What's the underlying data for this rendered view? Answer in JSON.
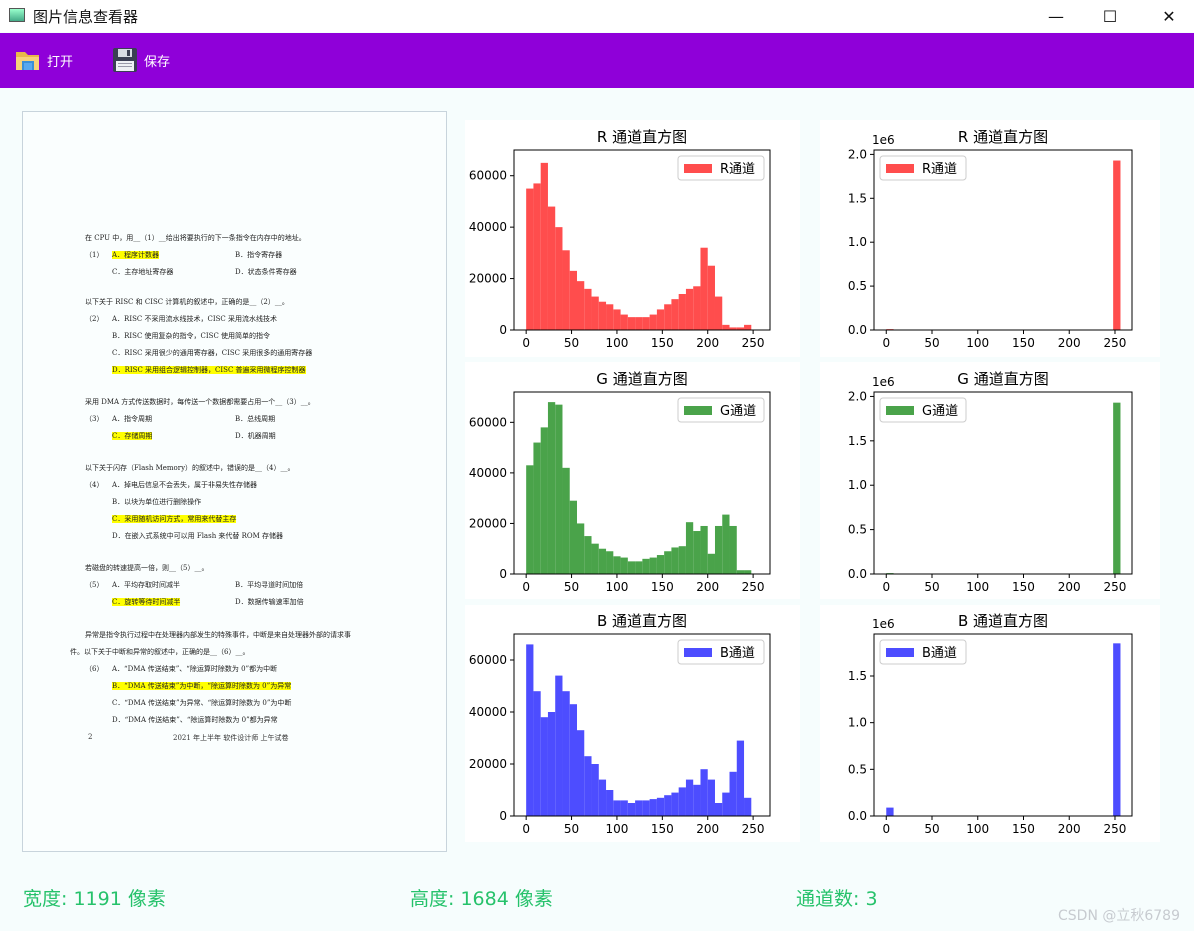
{
  "window": {
    "title": "图片信息查看器",
    "minimize": "—",
    "maximize": "☐",
    "close": "✕"
  },
  "toolbar": {
    "open": {
      "label": "打开",
      "icon": "folder-icon"
    },
    "save": {
      "label": "保存",
      "icon": "floppy-disk-icon"
    }
  },
  "document": {
    "questions": [
      {
        "stem": "在 CPU 中，用__（1）__给出将要执行的下一条指令在内存中的地址。",
        "rows": [
          [
            {
              "text": "（1）",
              "w": 27
            },
            {
              "text": "A．程序计数器",
              "w": 123,
              "hl": true
            },
            {
              "text": "B．指令寄存器"
            }
          ],
          [
            {
              "text": "",
              "w": 27
            },
            {
              "text": "C．主存地址寄存器",
              "w": 123
            },
            {
              "text": "D．状态条件寄存器"
            }
          ]
        ]
      },
      {
        "stem": "以下关于 RISC 和 CISC 计算机的叙述中，正确的是__（2）__。",
        "rows": [
          [
            {
              "text": "（2）",
              "w": 27
            },
            {
              "text": "A．RISC 不采用流水线技术，CISC 采用流水线技术"
            }
          ],
          [
            {
              "text": "",
              "w": 27
            },
            {
              "text": "B．RISC 使用复杂的指令，CISC 使用简单的指令"
            }
          ],
          [
            {
              "text": "",
              "w": 27
            },
            {
              "text": "C．RISC 采用很少的通用寄存器，CISC 采用很多的通用寄存器"
            }
          ],
          [
            {
              "text": "",
              "w": 27
            },
            {
              "text": "D．RISC 采用组合逻辑控制器，CISC 普遍采用微程序控制器",
              "hl": true
            }
          ]
        ]
      },
      {
        "stem": "采用 DMA 方式传送数据时，每传送一个数据都需要占用一个__（3）__。",
        "rows": [
          [
            {
              "text": "（3）",
              "w": 27
            },
            {
              "text": "A．指令周期",
              "w": 123
            },
            {
              "text": "B．总线周期"
            }
          ],
          [
            {
              "text": "",
              "w": 27
            },
            {
              "text": "C．存储周期",
              "w": 123,
              "hl": true
            },
            {
              "text": "D．机器周期"
            }
          ]
        ]
      },
      {
        "stem": "以下关于闪存（Flash Memory）的叙述中，错误的是__（4）__。",
        "rows": [
          [
            {
              "text": "（4）",
              "w": 27
            },
            {
              "text": "A．掉电后信息不会丢失，属于非易失性存储器"
            }
          ],
          [
            {
              "text": "",
              "w": 27
            },
            {
              "text": "B．以块为单位进行删除操作"
            }
          ],
          [
            {
              "text": "",
              "w": 27
            },
            {
              "text": "C．采用随机访问方式，常用来代替主存",
              "hl": true
            }
          ],
          [
            {
              "text": "",
              "w": 27
            },
            {
              "text": "D．在嵌入式系统中可以用 Flash 来代替 ROM 存储器"
            }
          ]
        ]
      },
      {
        "stem": "若磁盘的转速提高一倍，则__（5）__。",
        "rows": [
          [
            {
              "text": "（5）",
              "w": 27
            },
            {
              "text": "A．平均存取时间减半",
              "w": 123
            },
            {
              "text": "B．平均寻道时间加倍"
            }
          ],
          [
            {
              "text": "",
              "w": 27
            },
            {
              "text": "C．旋转等待时间减半",
              "w": 123,
              "hl": true
            },
            {
              "text": "D．数据传输速率加倍"
            }
          ]
        ]
      },
      {
        "stem": "异常是指令执行过程中在处理器内部发生的特殊事件，中断是来自处理器外部的请求事",
        "stem2": "件。以下关于中断和异常的叙述中，正确的是__（6）__。",
        "rows": [
          [
            {
              "text": "（6）",
              "w": 27
            },
            {
              "text": "A．“DMA 传送结束”、“除运算时除数为 0”都为中断"
            }
          ],
          [
            {
              "text": "",
              "w": 27
            },
            {
              "text": "B．“DMA 传送结束”为中断，“除运算时除数为 0”为异常",
              "hl": true
            }
          ],
          [
            {
              "text": "",
              "w": 27
            },
            {
              "text": "C．“DMA 传送结束”为异常、“除运算时除数为 0”为中断"
            }
          ],
          [
            {
              "text": "",
              "w": 27
            },
            {
              "text": "D．“DMA 传送结束”、“除运算时除数为 0”都为异常"
            }
          ]
        ]
      }
    ],
    "page_number": "2",
    "footer": "2021 年上半年  软件设计师  上午试卷"
  },
  "chart_data": [
    {
      "type": "bar",
      "title": "R 通道直方图",
      "legend": "R通道",
      "color": "#ff4d4d",
      "legend_loc": "upper right",
      "x_ticks": [
        0,
        50,
        100,
        150,
        200,
        250
      ],
      "y_ticks": [
        "0",
        "20000",
        "40000",
        "60000"
      ],
      "y_tick_values": [
        0,
        20000,
        40000,
        60000
      ],
      "ylim": [
        0,
        70000
      ],
      "bin_width": 8,
      "x_start": 0,
      "values": [
        55000,
        57000,
        65000,
        48000,
        40000,
        31000,
        23000,
        19000,
        16000,
        13000,
        11000,
        10000,
        8000,
        6000,
        5000,
        5000,
        5000,
        6000,
        8000,
        10000,
        12000,
        14000,
        16000,
        17000,
        32000,
        25000,
        13000,
        2000,
        1000,
        1000,
        2000
      ]
    },
    {
      "type": "bar",
      "title": "R 通道直方图",
      "legend": "R通道",
      "color": "#ff4d4d",
      "legend_loc": "upper left",
      "offset_text": "1e6",
      "x_ticks": [
        0,
        50,
        100,
        150,
        200,
        250
      ],
      "y_ticks": [
        "0.0",
        "0.5",
        "1.0",
        "1.5",
        "2.0"
      ],
      "y_tick_values": [
        0,
        0.5,
        1,
        1.5,
        2
      ],
      "ylim": [
        0,
        2.05
      ],
      "bin_width": 8,
      "x_start": 0,
      "sparse_values": [
        [
          0,
          0.01
        ],
        [
          248,
          1.93
        ]
      ]
    },
    {
      "type": "bar",
      "title": "G 通道直方图",
      "legend": "G通道",
      "color": "#4aa34a",
      "legend_loc": "upper right",
      "x_ticks": [
        0,
        50,
        100,
        150,
        200,
        250
      ],
      "y_ticks": [
        "0",
        "20000",
        "40000",
        "60000"
      ],
      "y_tick_values": [
        0,
        20000,
        40000,
        60000
      ],
      "ylim": [
        0,
        72000
      ],
      "bin_width": 8,
      "x_start": 0,
      "values": [
        43000,
        52000,
        58000,
        68000,
        67000,
        42000,
        29000,
        20000,
        15000,
        12000,
        10000,
        9000,
        7000,
        6500,
        5000,
        5000,
        6000,
        6500,
        7500,
        9000,
        10500,
        11000,
        20500,
        17000,
        19000,
        8000,
        19000,
        23500,
        19000,
        1500,
        1500
      ]
    },
    {
      "type": "bar",
      "title": "G 通道直方图",
      "legend": "G通道",
      "color": "#4aa34a",
      "legend_loc": "upper left",
      "offset_text": "1e6",
      "x_ticks": [
        0,
        50,
        100,
        150,
        200,
        250
      ],
      "y_ticks": [
        "0.0",
        "0.5",
        "1.0",
        "1.5",
        "2.0"
      ],
      "y_tick_values": [
        0,
        0.5,
        1,
        1.5,
        2
      ],
      "ylim": [
        0,
        2.05
      ],
      "bin_width": 8,
      "x_start": 0,
      "sparse_values": [
        [
          0,
          0.01
        ],
        [
          248,
          1.93
        ]
      ]
    },
    {
      "type": "bar",
      "title": "B 通道直方图",
      "legend": "B通道",
      "color": "#4d4dff",
      "legend_loc": "upper right",
      "x_ticks": [
        0,
        50,
        100,
        150,
        200,
        250
      ],
      "y_ticks": [
        "0",
        "20000",
        "40000",
        "60000"
      ],
      "y_tick_values": [
        0,
        20000,
        40000,
        60000
      ],
      "ylim": [
        0,
        70000
      ],
      "bin_width": 8,
      "x_start": 0,
      "values": [
        66000,
        48000,
        38000,
        40000,
        54000,
        48000,
        43000,
        33000,
        23000,
        20000,
        14000,
        10000,
        6000,
        6000,
        5000,
        6000,
        6000,
        6500,
        7000,
        8000,
        9000,
        11000,
        14000,
        12000,
        18000,
        14000,
        5000,
        9000,
        17000,
        29000,
        7000
      ]
    },
    {
      "type": "bar",
      "title": "B 通道直方图",
      "legend": "B通道",
      "color": "#4d4dff",
      "legend_loc": "upper left",
      "offset_text": "1e6",
      "x_ticks": [
        0,
        50,
        100,
        150,
        200,
        250
      ],
      "y_ticks": [
        "0.0",
        "0.5",
        "1.0",
        "1.5"
      ],
      "y_tick_values": [
        0,
        0.5,
        1,
        1.5
      ],
      "ylim": [
        0,
        1.95
      ],
      "bin_width": 8,
      "x_start": 0,
      "sparse_values": [
        [
          0,
          0.09
        ],
        [
          248,
          1.85
        ]
      ]
    }
  ],
  "stats": {
    "width": {
      "label": "宽度: ",
      "value": "1191",
      "unit": " 像素"
    },
    "height": {
      "label": "高度: ",
      "value": "1684",
      "unit": " 像素"
    },
    "channels": {
      "label": "通道数: ",
      "value": "3",
      "unit": ""
    }
  },
  "watermark": "CSDN @立秋6789"
}
